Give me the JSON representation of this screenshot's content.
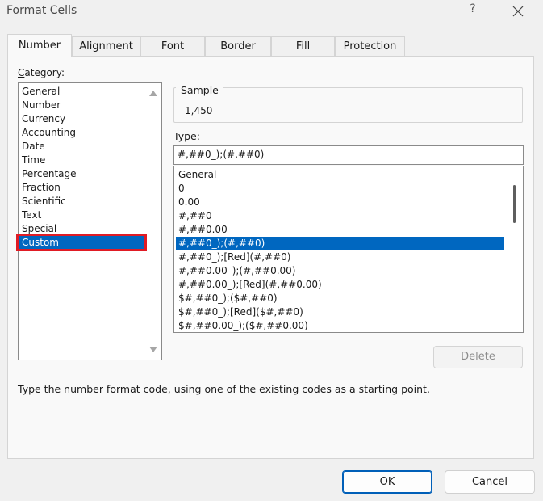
{
  "window": {
    "title": "Format Cells",
    "help": "?"
  },
  "tabs": [
    "Number",
    "Alignment",
    "Font",
    "Border",
    "Fill",
    "Protection"
  ],
  "active_tab": "Number",
  "category": {
    "label_hotkey": "C",
    "label_rest": "ategory:",
    "items": [
      "General",
      "Number",
      "Currency",
      "Accounting",
      "Date",
      "Time",
      "Percentage",
      "Fraction",
      "Scientific",
      "Text",
      "Special",
      "Custom"
    ],
    "selected": "Custom"
  },
  "sample": {
    "label": "Sample",
    "value": "1,450"
  },
  "type": {
    "label_hotkey": "T",
    "label_rest": "ype:",
    "value": "#,##0_);(#,##0)"
  },
  "formats": {
    "items": [
      "General",
      "0",
      "0.00",
      "#,##0",
      "#,##0.00",
      "#,##0_);(#,##0)",
      "#,##0_);[Red](#,##0)",
      "#,##0.00_);(#,##0.00)",
      "#,##0.00_);[Red](#,##0.00)",
      "$#,##0_);($#,##0)",
      "$#,##0_);[Red]($#,##0)",
      "$#,##0.00_);($#,##0.00)"
    ],
    "selected": "#,##0_);(#,##0)"
  },
  "delete_label": "Delete",
  "hint": "Type the number format code, using one of the existing codes as a starting point.",
  "buttons": {
    "ok": "OK",
    "cancel": "Cancel"
  },
  "colors": {
    "selection": "#0067c0",
    "highlight_border": "#e01b24",
    "ok_border": "#005fb8"
  }
}
